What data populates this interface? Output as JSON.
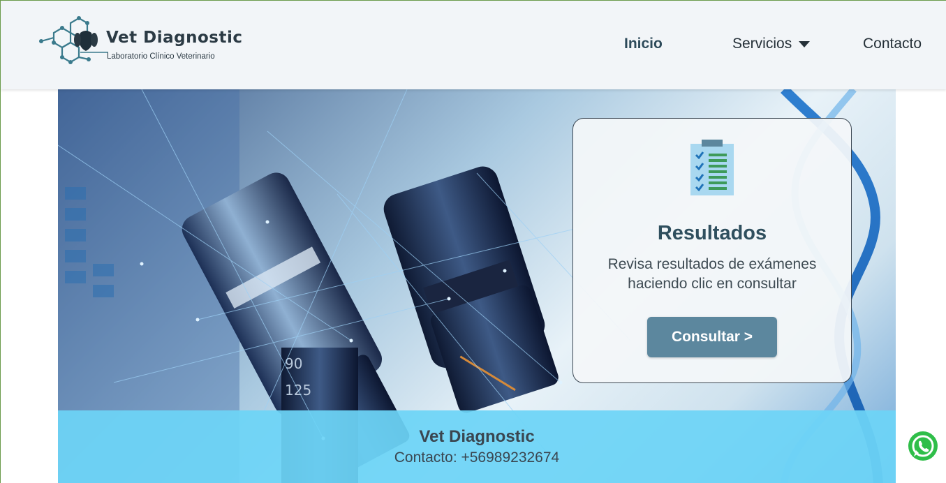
{
  "brand": {
    "name": "Vet Diagnostic",
    "tagline": "Laboratorio Clínico Veterinario",
    "logo_icon": "molecule-dog-icon"
  },
  "nav": {
    "items": [
      {
        "label": "Inicio",
        "active": true
      },
      {
        "label": "Servicios",
        "has_dropdown": true
      },
      {
        "label": "Contacto"
      }
    ]
  },
  "hero": {
    "background": "microscope-dna-photo",
    "card": {
      "icon": "clipboard-checklist-icon",
      "title": "Resultados",
      "description": "Revisa resultados de exámenes haciendo clic en consultar",
      "button_label": "Consultar >"
    }
  },
  "footer": {
    "title": "Vet Diagnostic",
    "contact": "Contacto: +56989232674"
  },
  "floating": {
    "icon": "whatsapp-icon"
  },
  "colors": {
    "header_bg": "#f2f5f8",
    "accent": "#5c879e",
    "footer_band": "#6dd4f6",
    "whatsapp": "#2fbe49"
  }
}
